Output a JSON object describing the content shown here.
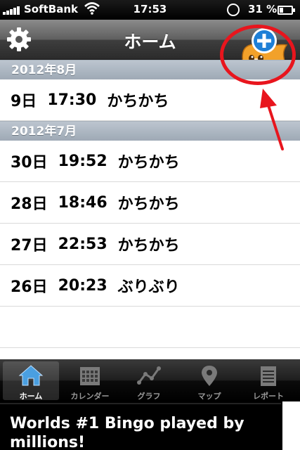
{
  "status_bar": {
    "carrier": "SoftBank",
    "time": "17:53",
    "battery_percent": "31 %",
    "battery_level": 0.31
  },
  "nav": {
    "title": "ホーム",
    "settings_icon": "gear-icon",
    "add_icon": "add-plus-icon"
  },
  "sections": [
    {
      "header": "2012年8月",
      "entries": [
        {
          "day": "9日",
          "time": "17:30",
          "label": "かちかち"
        }
      ]
    },
    {
      "header": "2012年7月",
      "entries": [
        {
          "day": "30日",
          "time": "19:52",
          "label": "かちかち"
        },
        {
          "day": "28日",
          "time": "18:46",
          "label": "かちかち"
        },
        {
          "day": "27日",
          "time": "22:53",
          "label": "かちかち"
        },
        {
          "day": "26日",
          "time": "20:23",
          "label": "ぶりぶり"
        }
      ]
    }
  ],
  "tabs": [
    {
      "label": "ホーム",
      "icon": "home-icon",
      "active": true
    },
    {
      "label": "カレンダー",
      "icon": "calendar-icon",
      "active": false
    },
    {
      "label": "グラフ",
      "icon": "graph-icon",
      "active": false
    },
    {
      "label": "マップ",
      "icon": "map-pin-icon",
      "active": false
    },
    {
      "label": "レポート",
      "icon": "report-icon",
      "active": false
    }
  ],
  "ad": {
    "text": "Worlds #1 Bingo played by millions!"
  },
  "colors": {
    "annotation_red": "#e8151d",
    "section_header": "#a8b2bd",
    "active_tab_icon": "#4a9fe0"
  }
}
